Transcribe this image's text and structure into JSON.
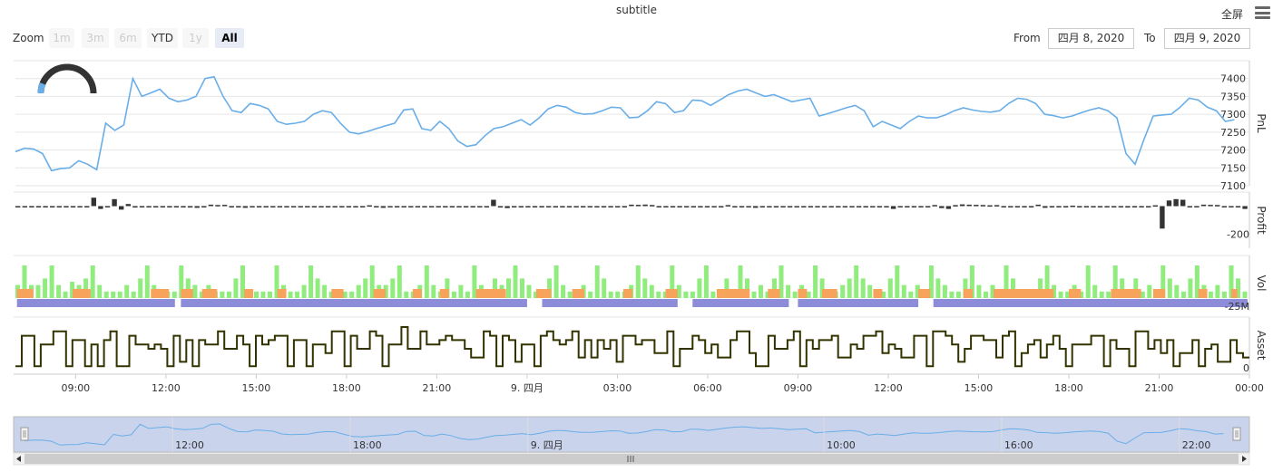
{
  "header": {
    "subtitle": "subtitle",
    "fullscreen_label": "全屏"
  },
  "zoom": {
    "label": "Zoom",
    "buttons": [
      {
        "label": "1m",
        "state": "disabled"
      },
      {
        "label": "3m",
        "state": "disabled"
      },
      {
        "label": "6m",
        "state": "disabled"
      },
      {
        "label": "YTD",
        "state": "enabled"
      },
      {
        "label": "1y",
        "state": "disabled"
      },
      {
        "label": "All",
        "state": "active"
      }
    ]
  },
  "range": {
    "from_label": "From",
    "from_value": "四月 8, 2020",
    "to_label": "To",
    "to_value": "四月 9, 2020"
  },
  "chart_data": {
    "type": "line",
    "x_axis": {
      "range_hours": [
        7,
        24
      ],
      "tick_labels": [
        {
          "hour": 9,
          "label": "09:00"
        },
        {
          "hour": 12,
          "label": "12:00"
        },
        {
          "hour": 15,
          "label": "15:00"
        },
        {
          "hour": 18,
          "label": "18:00"
        },
        {
          "hour": 21,
          "label": "21:00"
        },
        {
          "hour": 24,
          "label": "9. 四月"
        },
        {
          "hour": 27,
          "label": "03:00"
        },
        {
          "hour": 30,
          "label": "06:00"
        },
        {
          "hour": 33,
          "label": "09:00"
        },
        {
          "hour": 36,
          "label": "12:00"
        },
        {
          "hour": 39,
          "label": "15:00"
        },
        {
          "hour": 42,
          "label": "18:00"
        },
        {
          "hour": 45,
          "label": "21:00"
        },
        {
          "hour": 48,
          "label": "00:00"
        }
      ]
    },
    "panes": [
      {
        "title": "PnL",
        "type": "line",
        "color": "#6aaee8",
        "ylim": [
          7100,
          7450
        ],
        "ticks": [
          7100,
          7150,
          7200,
          7250,
          7300,
          7350,
          7400
        ],
        "x_hours": [
          7,
          7.3,
          7.6,
          7.9,
          8.2,
          8.5,
          8.8,
          9.1,
          9.4,
          9.7,
          10.0,
          10.3,
          10.6,
          10.9,
          11.2,
          11.5,
          11.8,
          12.1,
          12.4,
          12.7,
          13.0,
          13.3,
          13.6,
          13.9,
          14.2,
          14.5,
          14.8,
          15.1,
          15.4,
          15.7,
          16.0,
          16.3,
          16.6,
          16.9,
          17.2,
          17.5,
          17.8,
          18.1,
          18.4,
          18.7,
          19.0,
          19.3,
          19.6,
          19.9,
          20.2,
          20.5,
          20.8,
          21.1,
          21.4,
          21.7,
          22.0,
          22.3,
          22.6,
          22.9,
          23.2,
          23.5,
          23.8,
          24.1,
          24.4,
          24.7,
          25.0,
          25.3,
          25.6,
          25.9,
          26.2,
          26.5,
          26.8,
          27.1,
          27.4,
          27.7,
          28.0,
          28.3,
          28.6,
          28.9,
          29.2,
          29.5,
          29.8,
          30.1,
          30.4,
          30.7,
          31.0,
          31.3,
          31.6,
          31.9,
          32.2,
          32.5,
          32.8,
          33.1,
          33.4,
          33.7,
          34.0,
          34.3,
          34.6,
          34.9,
          35.2,
          35.5,
          35.8,
          36.1,
          36.4,
          36.7,
          37.0,
          37.3,
          37.6,
          37.9,
          38.2,
          38.5,
          38.8,
          39.1,
          39.4,
          39.7,
          40.0,
          40.3,
          40.6,
          40.9,
          41.2,
          41.5,
          41.8,
          42.1,
          42.4,
          42.7,
          43.0,
          43.3,
          43.6,
          43.9,
          44.2,
          44.5,
          44.8,
          45.1,
          45.4,
          45.7,
          46.0,
          46.3,
          46.6,
          46.9,
          47.2,
          47.5,
          47.8,
          48.0
        ],
        "values": [
          7195,
          7205,
          7203,
          7190,
          7142,
          7148,
          7150,
          7170,
          7160,
          7145,
          7275,
          7255,
          7270,
          7400,
          7350,
          7360,
          7370,
          7345,
          7335,
          7340,
          7350,
          7400,
          7405,
          7350,
          7310,
          7305,
          7330,
          7325,
          7315,
          7280,
          7272,
          7275,
          7280,
          7300,
          7310,
          7305,
          7275,
          7250,
          7245,
          7252,
          7260,
          7268,
          7275,
          7312,
          7315,
          7260,
          7255,
          7280,
          7260,
          7225,
          7210,
          7215,
          7240,
          7260,
          7265,
          7275,
          7285,
          7270,
          7290,
          7315,
          7325,
          7320,
          7305,
          7300,
          7302,
          7310,
          7320,
          7318,
          7290,
          7292,
          7310,
          7335,
          7330,
          7305,
          7310,
          7340,
          7338,
          7325,
          7340,
          7355,
          7365,
          7370,
          7360,
          7350,
          7355,
          7345,
          7335,
          7340,
          7345,
          7295,
          7302,
          7310,
          7318,
          7325,
          7310,
          7265,
          7280,
          7270,
          7260,
          7280,
          7295,
          7290,
          7290,
          7298,
          7310,
          7318,
          7312,
          7308,
          7306,
          7310,
          7330,
          7345,
          7342,
          7330,
          7300,
          7296,
          7290,
          7295,
          7304,
          7312,
          7318,
          7310,
          7290,
          7190,
          7160,
          7230,
          7295,
          7298,
          7300,
          7320,
          7345,
          7340,
          7320,
          7310,
          7280,
          7285
        ],
        "gauge": {
          "shown": true
        }
      },
      {
        "title": "Profit",
        "type": "bar",
        "color": "#333333",
        "ylim": [
          -300,
          100
        ],
        "ticks": [
          -200
        ],
        "values": [
          -3,
          -5,
          -6,
          -3,
          -5,
          -6,
          -7,
          -2,
          -4,
          -3,
          -5,
          60,
          -20,
          -3,
          50,
          -25,
          15,
          -10,
          -2,
          -5,
          -6,
          -5,
          -4,
          -7,
          -3,
          -10,
          -12,
          -7,
          10,
          8,
          9,
          -5,
          -8,
          -12,
          -7,
          -6,
          -3,
          -4,
          -5,
          -2,
          -7,
          -9,
          -6,
          -3,
          -2,
          -4,
          -5,
          -6,
          -3,
          -2,
          -8,
          6,
          -6,
          -12,
          -3,
          -4,
          -2,
          -5,
          -3,
          -4,
          -5,
          -6,
          -4,
          -2,
          -3,
          -5,
          -4,
          -6,
          -7,
          45,
          -10,
          -14,
          -3,
          -5,
          -6,
          -7,
          -8,
          -2,
          -3,
          -5,
          -4,
          -7,
          -6,
          -5,
          -3,
          -4,
          -2,
          -5,
          -8,
          10,
          9,
          11,
          8,
          -7,
          -5,
          -4,
          -6,
          -5,
          -4,
          -3,
          -7,
          -5,
          -3,
          7,
          -4,
          -5,
          -3,
          -12,
          -4,
          -6,
          -3,
          -4,
          -5,
          -3,
          -4,
          -6,
          -7,
          -3,
          -4,
          -5,
          -2,
          -3,
          -4,
          -6,
          -5,
          -3,
          -7,
          -20,
          -4,
          -5,
          -3,
          -2,
          -6,
          8,
          -14,
          -20,
          7,
          12,
          10,
          9,
          8,
          6,
          7,
          -6,
          -4,
          -5,
          -3,
          -7,
          10,
          -12,
          -4,
          -5,
          -6,
          3,
          -4,
          -5,
          -2,
          -3,
          -6,
          -7,
          -4,
          -10,
          -3,
          -5,
          -8,
          6,
          -160,
          40,
          50,
          45,
          -5,
          -4,
          10,
          9,
          8,
          -6,
          -5,
          -4,
          -20
        ]
      },
      {
        "title": "Vol",
        "type": "bar",
        "ylim": [
          -25,
          35
        ],
        "ticks": [
          -25
        ],
        "tick_suffix": "M",
        "colors": {
          "buy": "#90ed7d",
          "sell": "#f7a35c",
          "position": "#8c8cd9"
        },
        "buy_heights": [
          0.4,
          1,
          0.4,
          0.4,
          0.6,
          1,
          0.4,
          0.2,
          0.5,
          0.4,
          0.6,
          1,
          0.4,
          0.2,
          0.2,
          0.2,
          0.4,
          0.2,
          0.6,
          1,
          0.4,
          0.2,
          0.2,
          0.2,
          1,
          0.6,
          0.4,
          0.2,
          0.4,
          0.2,
          0.2,
          0.2,
          0.6,
          1,
          0.2,
          0.2,
          0.2,
          0.2,
          1,
          0.4,
          0.2,
          0.2,
          0.4,
          1,
          0.6,
          0.4,
          0.2,
          0.2,
          0.2,
          0.2,
          0.4,
          0.6,
          1,
          0.4,
          0.4,
          0.6,
          1,
          0.2,
          0.2,
          0.4,
          1,
          0.4,
          0.2,
          0.6,
          0.2,
          0.4,
          0.2,
          1,
          0.4,
          0.2,
          0.6,
          0.4,
          0.6,
          1,
          0.6,
          0.4,
          0.2,
          0.2,
          0.6,
          1,
          0.4,
          0.2,
          0.2,
          0.4,
          0.2,
          1,
          0.6,
          0.2,
          0.2,
          0.2,
          0.4,
          1,
          0.6,
          0.4,
          0.2,
          0.2,
          1,
          0.4,
          0.2,
          0.2,
          0.6,
          1,
          0.2,
          0.2,
          0.6,
          0.2,
          1,
          0.6,
          0.2,
          0.4,
          0.2,
          0.6,
          1,
          0.4,
          0.2,
          0.4,
          0.2,
          1,
          0.6,
          0.2,
          0.2,
          0.4,
          0.6,
          1,
          0.6,
          0.4,
          0.2,
          0.2,
          0.6,
          1,
          0.4,
          0.2,
          0.4,
          0.2,
          1,
          0.6,
          0.4,
          0.2,
          0.2,
          0.6,
          1,
          0.4,
          0.2,
          0.4,
          0.2,
          1,
          0.6,
          0.2,
          0.2,
          0.2,
          0.6,
          1,
          0.4,
          0.2,
          0.2,
          0.4,
          0.2,
          1,
          0.4,
          0.2,
          0.2,
          1,
          0.6,
          0.2,
          0.6,
          0.2,
          0.4,
          0.2,
          1,
          0.6,
          0.4,
          0.2,
          0.6,
          1,
          0.4,
          0.2,
          0.4,
          0.2,
          1,
          0.6,
          0.2
        ],
        "sell_segments_hours": [
          [
            7.05,
            7.6
          ],
          [
            8.9,
            9.5
          ],
          [
            11.5,
            12.1
          ],
          [
            12.5,
            12.9
          ],
          [
            13.2,
            13.7
          ],
          [
            14.6,
            14.9
          ],
          [
            15.7,
            16.0
          ],
          [
            17.5,
            17.9
          ],
          [
            18.9,
            19.3
          ],
          [
            20.2,
            20.5
          ],
          [
            21.1,
            21.4
          ],
          [
            22.3,
            23.3
          ],
          [
            24.3,
            24.8
          ],
          [
            25.5,
            25.9
          ],
          [
            27.2,
            27.5
          ],
          [
            28.6,
            29.0
          ],
          [
            30.3,
            30.6
          ],
          [
            30.6,
            31.4
          ],
          [
            32.0,
            32.4
          ],
          [
            33.0,
            33.3
          ],
          [
            33.8,
            34.3
          ],
          [
            35.5,
            35.8
          ],
          [
            37.0,
            37.4
          ],
          [
            38.5,
            38.8
          ],
          [
            39.5,
            41.5
          ],
          [
            42.0,
            42.4
          ],
          [
            43.4,
            44.4
          ],
          [
            44.8,
            45.2
          ],
          [
            46.3,
            46.6
          ],
          [
            47.4,
            47.6
          ]
        ],
        "position_segments_hours": [
          [
            7.05,
            12.3
          ],
          [
            12.5,
            24.0
          ],
          [
            24.5,
            29.0
          ],
          [
            29.5,
            32.7
          ],
          [
            33.0,
            37.0
          ],
          [
            37.5,
            48.0
          ]
        ]
      },
      {
        "title": "Asset",
        "type": "step-line",
        "color": "#333300",
        "ylim": [
          0,
          10
        ],
        "ticks": [
          0
        ],
        "values": [
          1,
          8,
          8,
          1,
          6,
          6,
          9,
          9,
          1,
          7,
          7,
          1,
          6,
          1,
          7,
          9,
          1,
          1,
          8,
          6,
          6,
          5,
          6,
          5,
          1,
          8,
          2,
          7,
          1,
          7,
          6,
          6,
          9,
          5,
          5,
          8,
          6,
          1,
          8,
          6,
          7,
          8,
          8,
          1,
          7,
          7,
          1,
          6,
          6,
          4,
          9,
          9,
          1,
          8,
          5,
          5,
          9,
          8,
          1,
          6,
          6,
          10,
          5,
          5,
          9,
          6,
          6,
          7,
          8,
          7,
          7,
          5,
          3,
          3,
          9,
          8,
          1,
          8,
          7,
          2,
          6,
          6,
          1,
          8,
          9,
          7,
          6,
          7,
          9,
          3,
          7,
          3,
          7,
          5,
          7,
          2,
          8,
          8,
          6,
          7,
          7,
          4,
          4,
          9,
          1,
          5,
          5,
          8,
          7,
          4,
          6,
          3,
          3,
          7,
          9,
          9,
          4,
          1,
          1,
          8,
          5,
          5,
          7,
          9,
          1,
          7,
          5,
          7,
          7,
          8,
          3,
          3,
          6,
          5,
          8,
          8,
          9,
          4,
          6,
          5,
          3,
          3,
          8,
          8,
          1,
          9,
          9,
          8,
          6,
          2,
          5,
          8,
          8,
          7,
          7,
          3,
          8,
          9,
          1,
          4,
          6,
          7,
          3,
          6,
          8,
          5,
          1,
          6,
          6,
          6,
          8,
          8,
          1,
          7,
          5,
          5,
          1,
          9,
          9,
          5,
          7,
          4,
          7,
          1,
          4,
          4,
          7,
          1,
          5,
          6,
          2,
          2,
          7,
          4,
          3
        ]
      }
    ],
    "navigator": {
      "tick_labels": [
        {
          "hour": 12,
          "label": "12:00"
        },
        {
          "hour": 18,
          "label": "18:00"
        },
        {
          "hour": 24,
          "label": "9. 四月"
        },
        {
          "hour": 34,
          "label": "10:00"
        },
        {
          "hour": 40,
          "label": "16:00"
        },
        {
          "hour": 46,
          "label": "22:00"
        }
      ],
      "range_hours": [
        7,
        48
      ],
      "series_color": "#6aaee8",
      "fill_color": "#c9d3ec"
    }
  }
}
